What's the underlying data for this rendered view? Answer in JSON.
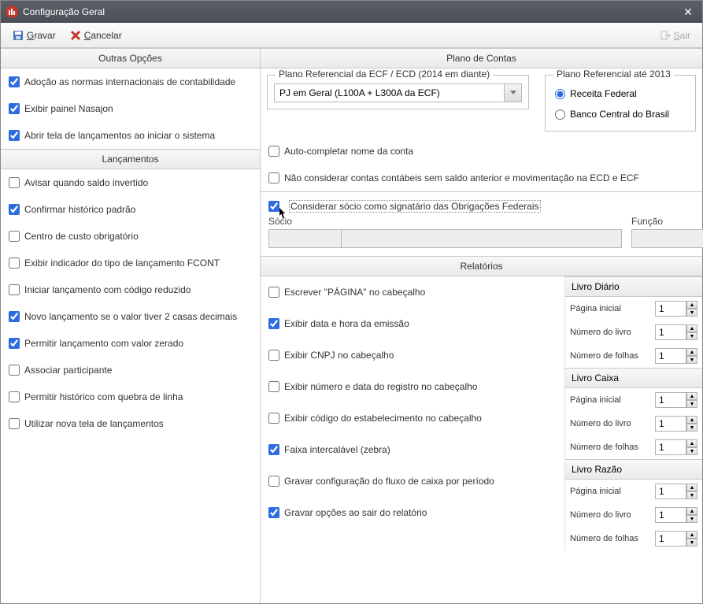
{
  "window": {
    "title": "Configuração Geral"
  },
  "toolbar": {
    "save_label": "Gravar",
    "cancel_label": "Cancelar",
    "exit_label": "Sair"
  },
  "left": {
    "header1": "Outras Opções",
    "opts1": [
      {
        "label": "Adoção as normas internacionais de contabilidade",
        "checked": true
      },
      {
        "label": "Exibir painel Nasajon",
        "checked": true
      },
      {
        "label": "Abrir tela de lançamentos ao iniciar o sistema",
        "checked": true
      }
    ],
    "header2": "Lançamentos",
    "opts2": [
      {
        "label": "Avisar quando saldo invertido",
        "checked": false
      },
      {
        "label": "Confirmar histórico padrão",
        "checked": true
      },
      {
        "label": "Centro de custo obrigatório",
        "checked": false
      },
      {
        "label": "Exibir indicador do tipo de lançamento FCONT",
        "checked": false
      },
      {
        "label": "Iniciar lançamento com código reduzido",
        "checked": false
      },
      {
        "label": "Novo lançamento se o valor tiver 2 casas decimais",
        "checked": true
      },
      {
        "label": "Permitir lançamento com valor zerado",
        "checked": true
      },
      {
        "label": "Associar participante",
        "checked": false
      },
      {
        "label": "Permitir histórico com quebra de linha",
        "checked": false
      },
      {
        "label": "Utilizar nova tela de lançamentos",
        "checked": false
      }
    ]
  },
  "right": {
    "header": "Plano de Contas",
    "ecf_legend": "Plano Referencial da ECF / ECD (2014 em diante)",
    "ecf_value": "PJ em Geral (L100A + L300A da ECF)",
    "ref2013_legend": "Plano Referencial até 2013",
    "ref2013_opts": [
      {
        "label": "Receita Federal",
        "checked": true
      },
      {
        "label": "Banco Central do Brasil",
        "checked": false
      }
    ],
    "checks": [
      {
        "label": "Auto-completar nome da conta",
        "checked": false
      },
      {
        "label": "Não considerar contas contábeis sem saldo anterior e movimentação na ECD e ECF",
        "checked": false
      }
    ],
    "signatario": {
      "label": "Considerar sócio como signatário das Obrigações Federais",
      "checked": true,
      "socio_label": "Sócio",
      "funcao_label": "Função",
      "socio_value": "",
      "socio_desc": "",
      "funcao_value": ""
    },
    "reports_header": "Relatórios",
    "report_checks": [
      {
        "label": "Escrever \"PÁGINA\" no cabeçalho",
        "checked": false
      },
      {
        "label": "Exibir data e hora da emissão",
        "checked": true
      },
      {
        "label": "Exibir CNPJ no cabeçalho",
        "checked": false
      },
      {
        "label": "Exibir número e data do registro no cabeçalho",
        "checked": false
      },
      {
        "label": "Exibir código do estabelecimento no cabeçalho",
        "checked": false
      },
      {
        "label": "Faixa intercalável (zebra)",
        "checked": true
      },
      {
        "label": "Gravar configuração do fluxo de caixa por período",
        "checked": false
      },
      {
        "label": "Gravar opções ao sair do relatório",
        "checked": true
      }
    ],
    "books": [
      {
        "title": "Livro Diário",
        "rows": [
          {
            "label": "Página inicial",
            "value": "1"
          },
          {
            "label": "Número do livro",
            "value": "1"
          },
          {
            "label": "Número de folhas",
            "value": "1"
          }
        ]
      },
      {
        "title": "Livro Caixa",
        "rows": [
          {
            "label": "Página inicial",
            "value": "1"
          },
          {
            "label": "Número do livro",
            "value": "1"
          },
          {
            "label": "Número de folhas",
            "value": "1"
          }
        ]
      },
      {
        "title": "Livro Razão",
        "rows": [
          {
            "label": "Página inicial",
            "value": "1"
          },
          {
            "label": "Número do livro",
            "value": "1"
          },
          {
            "label": "Número de folhas",
            "value": "1"
          }
        ]
      }
    ]
  }
}
